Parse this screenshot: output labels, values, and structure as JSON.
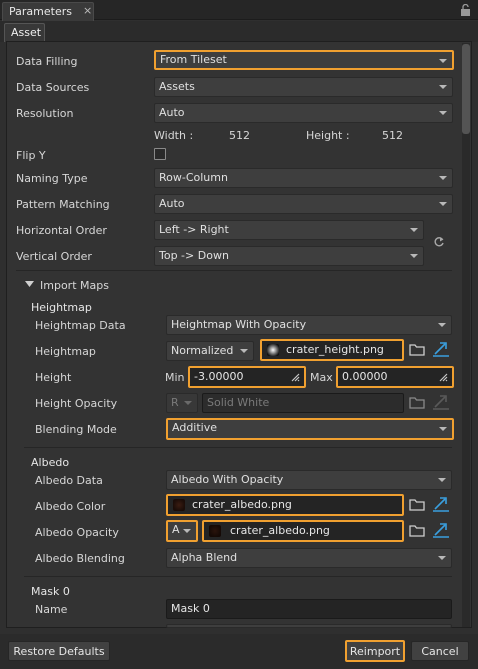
{
  "window": {
    "title": "Parameters",
    "close": "×"
  },
  "tabs": {
    "asset": "Asset"
  },
  "rows": {
    "data_filling": {
      "label": "Data Filling",
      "value": "From Tileset"
    },
    "data_sources": {
      "label": "Data Sources",
      "value": "Assets"
    },
    "resolution": {
      "label": "Resolution",
      "value": "Auto"
    },
    "width": {
      "label": "Width :",
      "value": "512"
    },
    "height_res": {
      "label": "Height :",
      "value": "512"
    },
    "flip_y": {
      "label": "Flip Y"
    },
    "naming_type": {
      "label": "Naming Type",
      "value": "Row-Column"
    },
    "pattern_matching": {
      "label": "Pattern Matching",
      "value": "Auto"
    },
    "horizontal_order": {
      "label": "Horizontal Order",
      "value": "Left -> Right"
    },
    "vertical_order": {
      "label": "Vertical Order",
      "value": "Top -> Down"
    }
  },
  "import_maps": {
    "label": "Import Maps"
  },
  "heightmap": {
    "section": "Heightmap",
    "data_label": "Heightmap Data",
    "data_value": "Heightmap With Opacity",
    "map_label": "Heightmap",
    "map_mode": "Normalized",
    "map_file": "crater_height.png",
    "height_label": "Height",
    "min_label": "Min",
    "min_value": "-3.00000",
    "max_label": "Max",
    "max_value": "0.00000",
    "opacity_label": "Height Opacity",
    "opacity_channel": "R",
    "opacity_value": "Solid White",
    "blend_label": "Blending Mode",
    "blend_value": "Additive"
  },
  "albedo": {
    "section": "Albedo",
    "data_label": "Albedo Data",
    "data_value": "Albedo With Opacity",
    "color_label": "Albedo Color",
    "color_file": "crater_albedo.png",
    "opacity_label": "Albedo Opacity",
    "opacity_channel": "A",
    "opacity_file": "crater_albedo.png",
    "blend_label": "Albedo Blending",
    "blend_value": "Alpha Blend"
  },
  "mask0": {
    "section": "Mask 0",
    "name_label": "Name",
    "name_value": "Mask 0"
  },
  "footer": {
    "restore": "Restore Defaults",
    "reimport": "Reimport",
    "cancel": "Cancel"
  },
  "colors": {
    "accent": "#f0a030",
    "background": "#333333",
    "field": "#242424"
  }
}
